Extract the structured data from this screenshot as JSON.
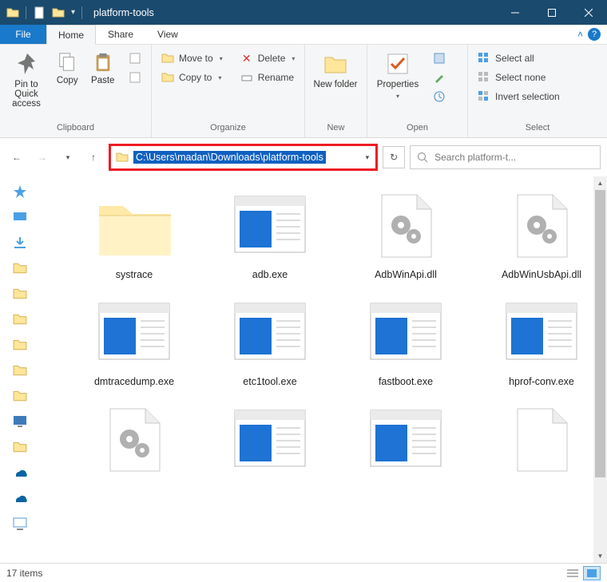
{
  "title": "platform-tools",
  "tabs": {
    "file": "File",
    "home": "Home",
    "share": "Share",
    "view": "View"
  },
  "ribbon": {
    "clipboard": {
      "label": "Clipboard",
      "pin": "Pin to Quick access",
      "copy": "Copy",
      "paste": "Paste"
    },
    "organize": {
      "label": "Organize",
      "moveto": "Move to",
      "copyto": "Copy to",
      "delete": "Delete",
      "rename": "Rename"
    },
    "new": {
      "label": "New",
      "newfolder": "New folder"
    },
    "open": {
      "label": "Open",
      "properties": "Properties"
    },
    "select": {
      "label": "Select",
      "selectall": "Select all",
      "selectnone": "Select none",
      "invert": "Invert selection"
    }
  },
  "address": {
    "path": "C:\\Users\\madan\\Downloads\\platform-tools",
    "search_placeholder": "Search platform-t..."
  },
  "items": [
    {
      "name": "systrace",
      "type": "folder"
    },
    {
      "name": "adb.exe",
      "type": "exe"
    },
    {
      "name": "AdbWinApi.dll",
      "type": "dll"
    },
    {
      "name": "AdbWinUsbApi.dll",
      "type": "dll"
    },
    {
      "name": "dmtracedump.exe",
      "type": "exe"
    },
    {
      "name": "etc1tool.exe",
      "type": "exe"
    },
    {
      "name": "fastboot.exe",
      "type": "exe"
    },
    {
      "name": "hprof-conv.exe",
      "type": "exe"
    },
    {
      "name": "",
      "type": "dll"
    },
    {
      "name": "",
      "type": "exe"
    },
    {
      "name": "",
      "type": "exe"
    },
    {
      "name": "",
      "type": "blank"
    }
  ],
  "status": {
    "count": "17 items"
  }
}
